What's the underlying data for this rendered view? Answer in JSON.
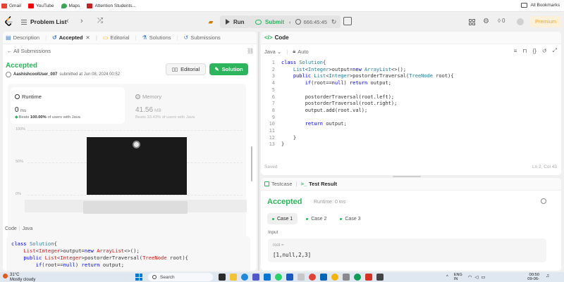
{
  "bookmarks": {
    "items": [
      {
        "label": "Gmail",
        "color": "#ea4335"
      },
      {
        "label": "YouTube",
        "color": "#ff0000"
      },
      {
        "label": "Maps",
        "color": "#34a853"
      },
      {
        "label": "Attention Students...",
        "color": "#c5221f"
      }
    ],
    "all_label": "All Bookmarks"
  },
  "navbar": {
    "problem_list": "Problem List",
    "run": "Run",
    "submit": "Submit",
    "timer": "666:45:45",
    "streak": "0",
    "premium": "Premium"
  },
  "left_tabs": [
    {
      "label": "Description",
      "icon": "doc-icon"
    },
    {
      "label": "Accepted",
      "icon": "history-icon"
    },
    {
      "label": "Editorial",
      "icon": "book-icon"
    },
    {
      "label": "Solutions",
      "icon": "flask-icon"
    },
    {
      "label": "Submissions",
      "icon": "history-icon"
    }
  ],
  "submission": {
    "back_label": "← All Submissions",
    "status": "Accepted",
    "user": "AashishcoolUser_007",
    "submitted_at": "submitted at Jun 08, 2024 00:52",
    "editorial_btn": "Editorial",
    "solution_btn": "Solution"
  },
  "runtime": {
    "label": "Runtime",
    "value": "0",
    "unit": "ms",
    "beats_label": "Beats",
    "beats_pct": "100.00%",
    "beats_suffix": "of users with Java"
  },
  "memory": {
    "label": "Memory",
    "value": "41.56",
    "unit": "MB",
    "beats_text": "Beats 33.43% of users with Java"
  },
  "chart": {
    "y_ticks": [
      "100%",
      "50%",
      "0%"
    ]
  },
  "code_preview": {
    "label": "Code",
    "lang": "Java"
  },
  "editor": {
    "title": "Code",
    "language": "Java",
    "mode": "Auto",
    "saved": "Saved",
    "cursor": "Ln 2, Col 43"
  },
  "results": {
    "tab_testcase": "Testcase",
    "tab_result": "Test Result",
    "status": "Accepted",
    "runtime": "Runtime: 0 ms",
    "cases": [
      "Case 1",
      "Case 2",
      "Case 3"
    ],
    "input_label": "Input",
    "input_var": "root =",
    "input_val": "[1,null,2,3]"
  },
  "taskbar": {
    "temp": "31°C",
    "weather": "Mostly cloudy",
    "search": "Search",
    "lang_1": "ENG",
    "lang_2": "IN",
    "time": "00:50",
    "date": "09-06-2024"
  },
  "colors": {
    "accent_green": "#2db55d",
    "premium_orange": "#ffa116"
  }
}
